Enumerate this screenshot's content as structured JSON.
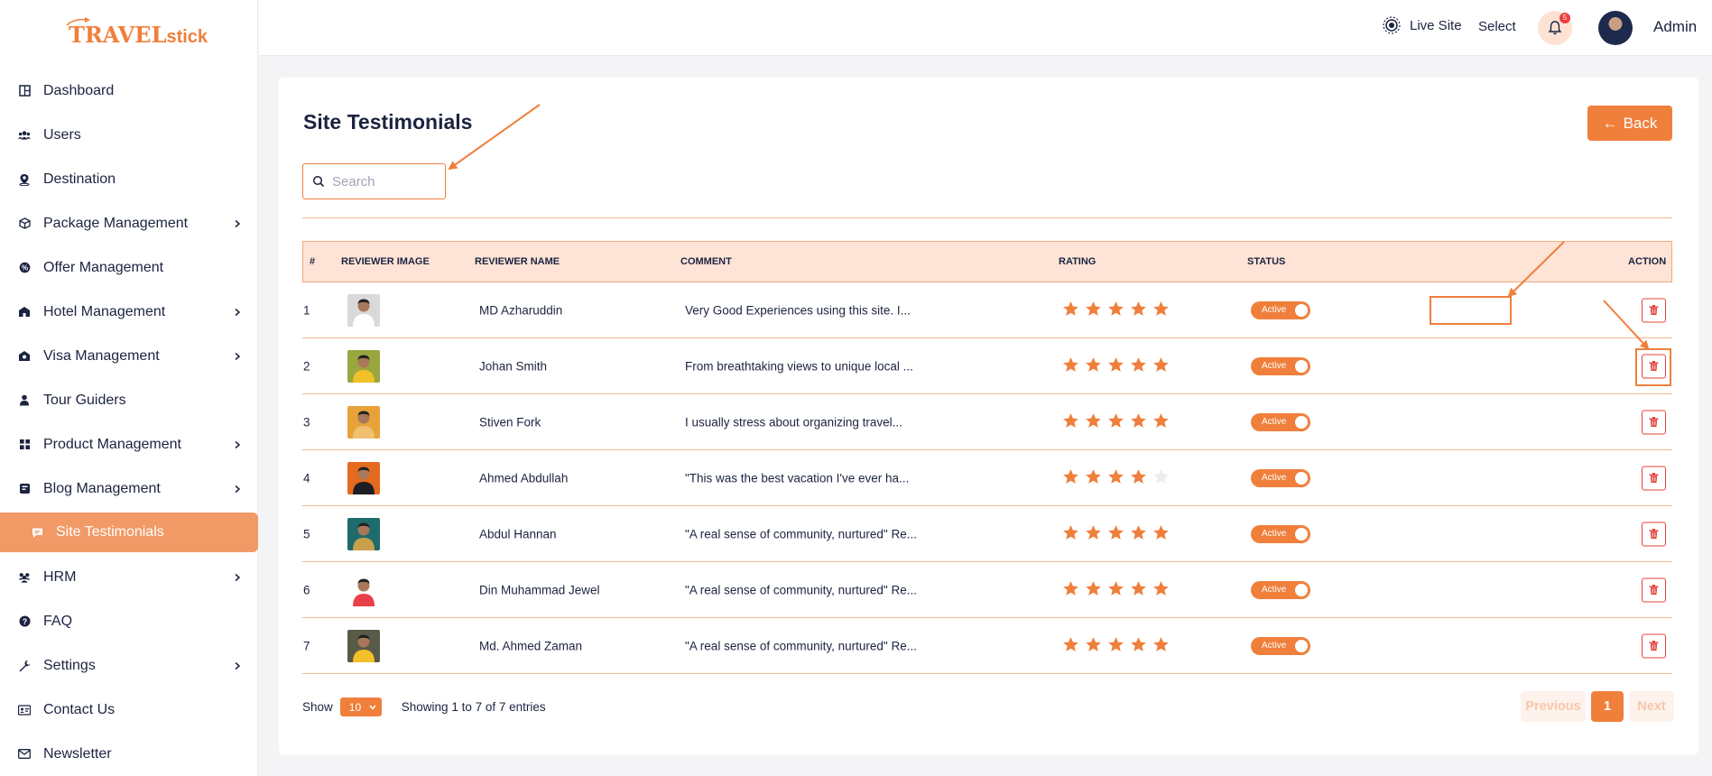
{
  "brand": {
    "logo_text_main": "TRAVEL",
    "logo_text_small": "stick"
  },
  "colors": {
    "accent": "#f07f3c",
    "accent_light": "#fde4d6",
    "danger": "#e0433c",
    "text": "#1c2340"
  },
  "sidebar": {
    "items": [
      {
        "label": "Dashboard",
        "icon": "dashboard-icon",
        "has_children": false
      },
      {
        "label": "Users",
        "icon": "users-icon",
        "has_children": false
      },
      {
        "label": "Destination",
        "icon": "location-pin-icon",
        "has_children": false
      },
      {
        "label": "Package Management",
        "icon": "box-icon",
        "has_children": true
      },
      {
        "label": "Offer Management",
        "icon": "badge-icon",
        "has_children": false
      },
      {
        "label": "Hotel Management",
        "icon": "hotel-icon",
        "has_children": true
      },
      {
        "label": "Visa Management",
        "icon": "visa-icon",
        "has_children": true
      },
      {
        "label": "Tour Guiders",
        "icon": "person-icon",
        "has_children": false
      },
      {
        "label": "Product Management",
        "icon": "grid-icon",
        "has_children": true
      },
      {
        "label": "Blog Management",
        "icon": "blog-icon",
        "has_children": true
      },
      {
        "label": "Site Testimonials",
        "icon": "comment-icon",
        "has_children": false,
        "active": true
      },
      {
        "label": "HRM",
        "icon": "team-icon",
        "has_children": true
      },
      {
        "label": "FAQ",
        "icon": "question-icon",
        "has_children": false
      },
      {
        "label": "Settings",
        "icon": "wrench-icon",
        "has_children": true
      },
      {
        "label": "Contact Us",
        "icon": "contact-card-icon",
        "has_children": false
      },
      {
        "label": "Newsletter",
        "icon": "mail-icon",
        "has_children": false
      }
    ]
  },
  "topbar": {
    "live_site_label": "Live Site",
    "select_label": "Select",
    "notification_count": "5",
    "user_name": "Admin"
  },
  "page": {
    "title": "Site Testimonials",
    "back_label": "Back",
    "search_placeholder": "Search"
  },
  "table": {
    "headers": {
      "index": "#",
      "image": "REVIEWER IMAGE",
      "name": "REVIEWER NAME",
      "comment": "COMMENT",
      "rating": "RATING",
      "status": "STATUS",
      "action": "ACTION"
    },
    "rows": [
      {
        "index": "1",
        "name": "MD Azharuddin",
        "comment": "Very Good Experiences using this site. I...",
        "rating": 5,
        "status": "Active",
        "photo_bg": "#d9d9d9",
        "shirt": "#ffffff"
      },
      {
        "index": "2",
        "name": "Johan Smith",
        "comment": "From breathtaking views to unique local ...",
        "rating": 5,
        "status": "Active",
        "photo_bg": "#9aa640",
        "shirt": "#f2c028"
      },
      {
        "index": "3",
        "name": "Stiven Fork",
        "comment": "I usually stress about organizing travel...",
        "rating": 5,
        "status": "Active",
        "photo_bg": "#e7a33a",
        "shirt": "#f0c070"
      },
      {
        "index": "4",
        "name": "Ahmed Abdullah",
        "comment": "\"This was the best vacation I've ever ha...",
        "rating": 4,
        "status": "Active",
        "photo_bg": "#e56a1f",
        "shirt": "#1e1e24"
      },
      {
        "index": "5",
        "name": "Abdul Hannan",
        "comment": "\"A real sense of community, nurtured\" Re...",
        "rating": 5,
        "status": "Active",
        "photo_bg": "#1f6b6b",
        "shirt": "#c9a04a"
      },
      {
        "index": "6",
        "name": "Din Muhammad Jewel",
        "comment": "\"A real sense of community, nurtured\" Re...",
        "rating": 5,
        "status": "Active",
        "photo_bg": "#ffffff",
        "shirt": "#e8404a"
      },
      {
        "index": "7",
        "name": "Md. Ahmed Zaman",
        "comment": "\"A real sense of community, nurtured\" Re...",
        "rating": 5,
        "status": "Active",
        "photo_bg": "#5a5a48",
        "shirt": "#f2c028"
      }
    ]
  },
  "footer": {
    "show_label": "Show",
    "page_size": "10",
    "showing_text": "Showing 1 to 7 of 7 entries",
    "prev_label": "Previous",
    "current_page": "1",
    "next_label": "Next"
  }
}
